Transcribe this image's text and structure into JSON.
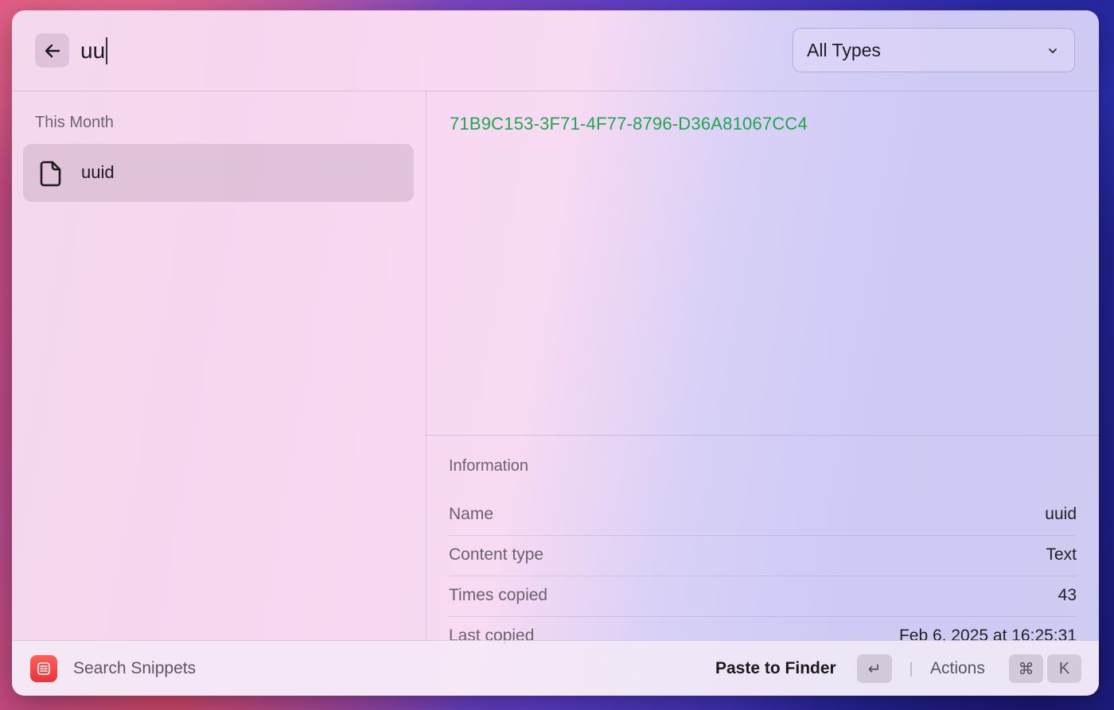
{
  "header": {
    "back_icon": "arrow-left-icon",
    "search_value": "uu",
    "type_filter": {
      "selected": "All Types",
      "icon": "chevron-down-icon"
    }
  },
  "list": {
    "section_title": "This Month",
    "items": [
      {
        "label": "uuid",
        "icon": "document-icon",
        "selected": true
      }
    ]
  },
  "detail": {
    "preview": "71B9C153-3F71-4F77-8796-D36A81067CC4",
    "preview_color": "#1fa64f",
    "info_title": "Information",
    "info": [
      {
        "key": "Name",
        "value": "uuid"
      },
      {
        "key": "Content type",
        "value": "Text"
      },
      {
        "key": "Times copied",
        "value": "43"
      },
      {
        "key": "Last copied",
        "value": "Feb 6, 2025 at 16:25:31"
      }
    ]
  },
  "footer": {
    "app_icon": "snippets-app-icon",
    "title": "Search Snippets",
    "primary_action": "Paste to Finder",
    "primary_shortcut": "↵",
    "actions_label": "Actions",
    "actions_shortcut_mod": "⌘",
    "actions_shortcut_key": "K"
  }
}
